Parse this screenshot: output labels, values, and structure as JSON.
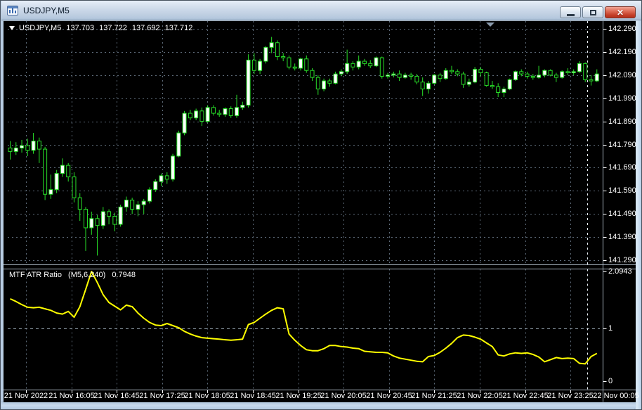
{
  "window": {
    "title": "USDJPY,M5",
    "controls": [
      {
        "name": "minimize",
        "icon": "minimize-icon"
      },
      {
        "name": "restore",
        "icon": "restore-icon"
      },
      {
        "name": "close",
        "icon": "close-icon"
      }
    ]
  },
  "main_chart": {
    "symbol_label": "USDJPY,M5",
    "open": "137.703",
    "high": "137.722",
    "low": "137.692",
    "close": "137.712"
  },
  "indicator_panel": {
    "name": "MTF ATR Ratio",
    "params": "(M5,6,240)",
    "value": "0.7948",
    "axis_labels": [
      "2.0943",
      "1",
      "0"
    ]
  },
  "price_axis": {
    "labels": [
      "142.290",
      "142.190",
      "142.090",
      "141.990",
      "141.890",
      "141.790",
      "141.690",
      "141.590",
      "141.490",
      "141.390",
      "141.290"
    ]
  },
  "time_axis": {
    "labels": [
      "21 Nov 2022",
      "21 Nov 16:05",
      "21 Nov 16:45",
      "21 Nov 17:25",
      "21 Nov 18:05",
      "21 Nov 18:45",
      "21 Nov 19:25",
      "21 Nov 20:05",
      "21 Nov 20:45",
      "21 Nov 21:25",
      "21 Nov 22:05",
      "21 Nov 22:45",
      "21 Nov 23:25",
      "22 Nov 00:05"
    ]
  },
  "colors": {
    "background": "#000000",
    "grid": "#5d6a78",
    "level_line": "#93a0ac",
    "day_separator": "#e8eef4",
    "candle_outline": "#28df28",
    "bull_body": "#ffffff",
    "bear_body": "#000000",
    "indicator_line": "#ffff00",
    "axis_text": "#ffffff",
    "panel_border": "#a8b4c0",
    "shift_marker": "#8a9aac"
  },
  "chart_data": {
    "type": "candlestick",
    "symbol": "USDJPY",
    "timeframe": "M5",
    "x_tick_labels": [
      "21 Nov 2022",
      "21 Nov 16:05",
      "21 Nov 16:45",
      "21 Nov 17:25",
      "21 Nov 18:05",
      "21 Nov 18:45",
      "21 Nov 19:25",
      "21 Nov 20:05",
      "21 Nov 20:45",
      "21 Nov 21:25",
      "21 Nov 22:05",
      "21 Nov 22:45",
      "21 Nov 23:25",
      "22 Nov 00:05"
    ],
    "price_ticks": [
      142.29,
      142.19,
      142.09,
      141.99,
      141.89,
      141.79,
      141.69,
      141.59,
      141.49,
      141.39,
      141.29
    ],
    "candles_ohlc": [
      [
        141.775,
        141.805,
        141.725,
        141.76
      ],
      [
        141.76,
        141.8,
        141.745,
        141.775
      ],
      [
        141.775,
        141.81,
        141.755,
        141.785
      ],
      [
        141.785,
        141.815,
        141.74,
        141.765
      ],
      [
        141.765,
        141.84,
        141.75,
        141.805
      ],
      [
        141.805,
        141.82,
        141.71,
        141.77
      ],
      [
        141.77,
        141.78,
        141.55,
        141.575
      ],
      [
        141.575,
        141.66,
        141.555,
        141.595
      ],
      [
        141.595,
        141.68,
        141.58,
        141.665
      ],
      [
        141.665,
        141.73,
        141.65,
        141.7
      ],
      [
        141.7,
        141.71,
        141.63,
        141.65
      ],
      [
        141.65,
        141.67,
        141.54,
        141.56
      ],
      [
        141.56,
        141.58,
        141.46,
        141.51
      ],
      [
        141.51,
        141.52,
        141.33,
        141.43
      ],
      [
        141.43,
        141.5,
        141.4,
        141.47
      ],
      [
        141.47,
        141.485,
        141.31,
        141.44
      ],
      [
        141.44,
        141.52,
        141.425,
        141.5
      ],
      [
        141.5,
        141.51,
        141.445,
        141.48
      ],
      [
        141.48,
        141.495,
        141.415,
        141.445
      ],
      [
        141.445,
        141.53,
        141.435,
        141.52
      ],
      [
        141.52,
        141.565,
        141.5,
        141.55
      ],
      [
        141.55,
        141.56,
        141.49,
        141.51
      ],
      [
        141.51,
        141.545,
        141.48,
        141.53
      ],
      [
        141.53,
        141.555,
        141.49,
        141.545
      ],
      [
        141.545,
        141.605,
        141.535,
        141.595
      ],
      [
        141.595,
        141.64,
        141.585,
        141.63
      ],
      [
        141.63,
        141.665,
        141.61,
        141.655
      ],
      [
        141.655,
        141.67,
        141.62,
        141.64
      ],
      [
        141.64,
        141.75,
        141.63,
        141.74
      ],
      [
        141.74,
        141.85,
        141.735,
        141.84
      ],
      [
        141.84,
        141.935,
        141.83,
        141.925
      ],
      [
        141.925,
        141.94,
        141.895,
        141.905
      ],
      [
        141.905,
        141.945,
        141.895,
        141.935
      ],
      [
        141.935,
        141.95,
        141.87,
        141.89
      ],
      [
        141.89,
        141.96,
        141.885,
        141.95
      ],
      [
        141.95,
        141.96,
        141.915,
        141.925
      ],
      [
        141.925,
        141.94,
        141.91,
        141.92
      ],
      [
        141.92,
        141.95,
        141.91,
        141.945
      ],
      [
        141.945,
        141.955,
        141.905,
        141.915
      ],
      [
        141.915,
        142.005,
        141.905,
        141.95
      ],
      [
        141.95,
        141.975,
        141.94,
        141.96
      ],
      [
        141.96,
        142.18,
        141.95,
        142.155
      ],
      [
        142.155,
        142.185,
        142.095,
        142.11
      ],
      [
        142.11,
        142.16,
        142.095,
        142.15
      ],
      [
        142.15,
        142.215,
        142.14,
        142.21
      ],
      [
        142.21,
        142.255,
        142.185,
        142.23
      ],
      [
        142.23,
        142.24,
        142.155,
        142.17
      ],
      [
        142.17,
        142.185,
        142.15,
        142.165
      ],
      [
        142.165,
        142.175,
        142.115,
        142.125
      ],
      [
        142.125,
        142.14,
        142.11,
        142.12
      ],
      [
        142.12,
        142.165,
        142.11,
        142.16
      ],
      [
        142.16,
        142.175,
        142.1,
        142.11
      ],
      [
        142.11,
        142.12,
        142.065,
        142.08
      ],
      [
        142.08,
        142.09,
        142.005,
        142.03
      ],
      [
        142.03,
        142.075,
        142.02,
        142.065
      ],
      [
        142.065,
        142.075,
        142.04,
        142.055
      ],
      [
        142.055,
        142.105,
        142.05,
        142.095
      ],
      [
        142.095,
        142.115,
        142.085,
        142.105
      ],
      [
        142.105,
        142.2,
        142.095,
        142.14
      ],
      [
        142.14,
        142.15,
        142.11,
        142.125
      ],
      [
        142.125,
        142.175,
        142.115,
        142.15
      ],
      [
        142.15,
        142.16,
        142.13,
        142.14
      ],
      [
        142.14,
        142.155,
        142.12,
        142.13
      ],
      [
        142.13,
        142.17,
        142.125,
        142.165
      ],
      [
        142.165,
        142.17,
        142.075,
        142.085
      ],
      [
        142.085,
        142.1,
        142.075,
        142.09
      ],
      [
        142.09,
        142.105,
        142.08,
        142.095
      ],
      [
        142.095,
        142.11,
        142.065,
        142.08
      ],
      [
        142.08,
        142.1,
        142.075,
        142.09
      ],
      [
        142.09,
        142.1,
        142.07,
        142.085
      ],
      [
        142.085,
        142.095,
        142.05,
        142.06
      ],
      [
        142.06,
        142.08,
        142.0,
        142.03
      ],
      [
        142.03,
        142.065,
        142.01,
        142.055
      ],
      [
        142.055,
        142.095,
        142.05,
        142.09
      ],
      [
        142.09,
        142.1,
        142.06,
        142.075
      ],
      [
        142.075,
        142.12,
        142.07,
        142.11
      ],
      [
        142.11,
        142.13,
        142.095,
        142.105
      ],
      [
        142.105,
        142.115,
        142.085,
        142.095
      ],
      [
        142.095,
        142.105,
        142.035,
        142.05
      ],
      [
        142.05,
        142.075,
        142.04,
        142.06
      ],
      [
        142.06,
        142.125,
        142.055,
        142.115
      ],
      [
        142.115,
        142.125,
        142.085,
        142.1
      ],
      [
        142.1,
        142.105,
        142.04,
        142.045
      ],
      [
        142.045,
        142.065,
        142.03,
        142.04
      ],
      [
        142.04,
        142.055,
        141.995,
        142.015
      ],
      [
        142.015,
        142.04,
        141.995,
        142.03
      ],
      [
        142.03,
        142.075,
        142.025,
        142.07
      ],
      [
        142.07,
        142.11,
        142.065,
        142.105
      ],
      [
        142.105,
        142.115,
        142.085,
        142.095
      ],
      [
        142.095,
        142.105,
        142.075,
        142.085
      ],
      [
        142.085,
        142.095,
        142.07,
        142.08
      ],
      [
        142.08,
        142.13,
        142.075,
        142.09
      ],
      [
        142.09,
        142.115,
        142.08,
        142.11
      ],
      [
        142.11,
        142.115,
        142.085,
        142.09
      ],
      [
        142.09,
        142.1,
        142.06,
        142.08
      ],
      [
        142.08,
        142.11,
        142.075,
        142.105
      ],
      [
        142.105,
        142.12,
        142.09,
        142.1
      ],
      [
        142.1,
        142.115,
        142.09,
        142.105
      ],
      [
        142.105,
        142.15,
        142.1,
        142.14
      ],
      [
        142.14,
        142.145,
        142.06,
        142.07
      ],
      [
        142.07,
        142.09,
        142.045,
        142.065
      ],
      [
        142.065,
        142.115,
        142.06,
        142.095
      ]
    ],
    "indicator": {
      "name": "MTF ATR Ratio",
      "params": "(M5,6,240)",
      "last_value": 0.7948,
      "axis_max": 2.0943,
      "axis_min": 0,
      "level": 1,
      "values": [
        1.57,
        1.52,
        1.46,
        1.41,
        1.4,
        1.41,
        1.38,
        1.35,
        1.3,
        1.28,
        1.33,
        1.22,
        1.42,
        1.75,
        2.09,
        1.88,
        1.65,
        1.5,
        1.43,
        1.36,
        1.45,
        1.42,
        1.3,
        1.2,
        1.12,
        1.07,
        1.06,
        1.1,
        1.06,
        1.02,
        0.95,
        0.9,
        0.86,
        0.83,
        0.82,
        0.81,
        0.8,
        0.79,
        0.78,
        0.79,
        0.8,
        1.08,
        1.12,
        1.2,
        1.28,
        1.35,
        1.4,
        1.38,
        0.9,
        0.78,
        0.68,
        0.6,
        0.58,
        0.58,
        0.62,
        0.68,
        0.68,
        0.66,
        0.65,
        0.63,
        0.62,
        0.57,
        0.56,
        0.55,
        0.55,
        0.54,
        0.48,
        0.44,
        0.42,
        0.4,
        0.38,
        0.37,
        0.47,
        0.49,
        0.55,
        0.63,
        0.72,
        0.83,
        0.88,
        0.87,
        0.84,
        0.8,
        0.73,
        0.66,
        0.5,
        0.48,
        0.52,
        0.54,
        0.53,
        0.54,
        0.51,
        0.46,
        0.37,
        0.41,
        0.45,
        0.43,
        0.44,
        0.43,
        0.34,
        0.33,
        0.47,
        0.53
      ]
    }
  }
}
